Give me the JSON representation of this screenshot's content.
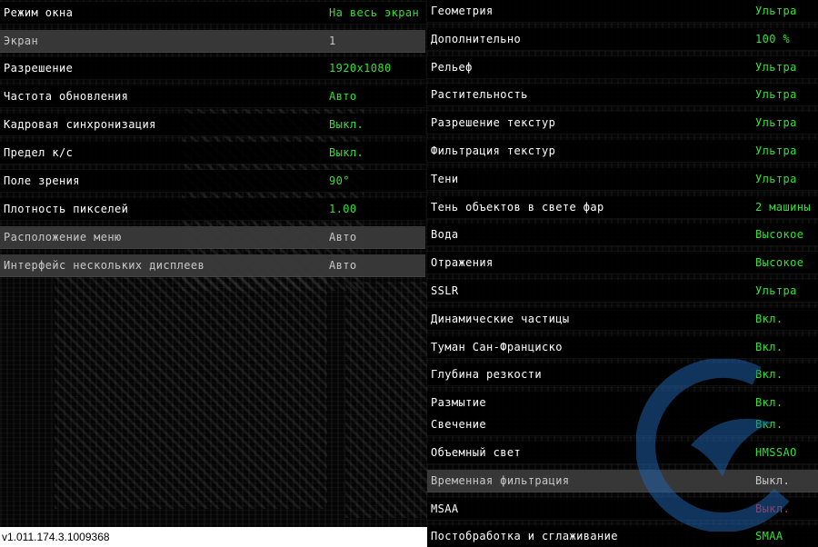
{
  "left_settings": [
    {
      "label": "Режим окна",
      "value": "На весь экран",
      "value_color": "green",
      "highlighted": false
    },
    {
      "label": "Экран",
      "value": "1",
      "value_color": "white",
      "highlighted": true
    },
    {
      "label": "Разрешение",
      "value": "1920x1080",
      "value_color": "green",
      "highlighted": false
    },
    {
      "label": "Частота обновления",
      "value": "Авто",
      "value_color": "green",
      "highlighted": false
    },
    {
      "label": "Кадровая синхронизация",
      "value": "Выкл.",
      "value_color": "green",
      "highlighted": false
    },
    {
      "label": "Предел к/с",
      "value": "Выкл.",
      "value_color": "green",
      "highlighted": false
    },
    {
      "label": "Поле зрения",
      "value": "90°",
      "value_color": "green",
      "highlighted": false
    },
    {
      "label": "Плотность пикселей",
      "value": "1.00",
      "value_color": "green",
      "highlighted": false
    },
    {
      "label": "Расположение меню",
      "value": "Авто",
      "value_color": "white",
      "highlighted": true
    },
    {
      "label": "Интерфейс нескольких дисплеев",
      "value": "Авто",
      "value_color": "white",
      "highlighted": true
    }
  ],
  "right_settings": [
    {
      "label": "Геометрия",
      "value": "Ультра",
      "value_color": "green",
      "highlighted": false
    },
    {
      "label": "Дополнительно",
      "value": "100 %",
      "value_color": "green",
      "highlighted": false
    },
    {
      "label": "Рельеф",
      "value": "Ультра",
      "value_color": "green",
      "highlighted": false
    },
    {
      "label": "Растительность",
      "value": "Ультра",
      "value_color": "green",
      "highlighted": false
    },
    {
      "label": "Разрешение текстур",
      "value": "Ультра",
      "value_color": "green",
      "highlighted": false
    },
    {
      "label": "Фильтрация текстур",
      "value": "Ультра",
      "value_color": "green",
      "highlighted": false
    },
    {
      "label": "Тени",
      "value": "Ультра",
      "value_color": "green",
      "highlighted": false
    },
    {
      "label": "Тень объектов в свете фар",
      "value": "2 машины",
      "value_color": "green",
      "highlighted": false
    },
    {
      "label": "Вода",
      "value": "Высокое",
      "value_color": "green",
      "highlighted": false
    },
    {
      "label": "Отражения",
      "value": "Высокое",
      "value_color": "green",
      "highlighted": false
    },
    {
      "label": "SSLR",
      "value": "Ультра",
      "value_color": "green",
      "highlighted": false
    },
    {
      "label": "Динамические частицы",
      "value": "Вкл.",
      "value_color": "green",
      "highlighted": false
    },
    {
      "label": "Туман Сан-Франциско",
      "value": "Вкл.",
      "value_color": "green",
      "highlighted": false
    },
    {
      "label": "Глубина резкости",
      "value": "Вкл.",
      "value_color": "green",
      "highlighted": false
    },
    {
      "label": "Размытие",
      "value": "Вкл.",
      "value_color": "green",
      "highlighted": false
    },
    {
      "label": "Свечение",
      "value": "Вкл.",
      "value_color": "green",
      "highlighted": false
    },
    {
      "label": "Объемный свет",
      "value": "HMSSAO",
      "value_color": "green",
      "highlighted": false
    },
    {
      "label": "Временная фильтрация",
      "value": "Выкл.",
      "value_color": "white",
      "highlighted": true
    },
    {
      "label": "MSAA",
      "value": "Выкл.",
      "value_color": "red",
      "highlighted": false
    },
    {
      "label": "Постобработка и сглаживание",
      "value": "SMAA",
      "value_color": "green",
      "highlighted": false
    }
  ],
  "version": "v1.011.174.3.1009368",
  "colors": {
    "value_green": "#33e033",
    "value_red": "#e83030",
    "highlight_row": "#3a3a3a",
    "watermark_blue": "#1e5fa8"
  },
  "icons": {
    "watermark": "logo-watermark-icon"
  }
}
